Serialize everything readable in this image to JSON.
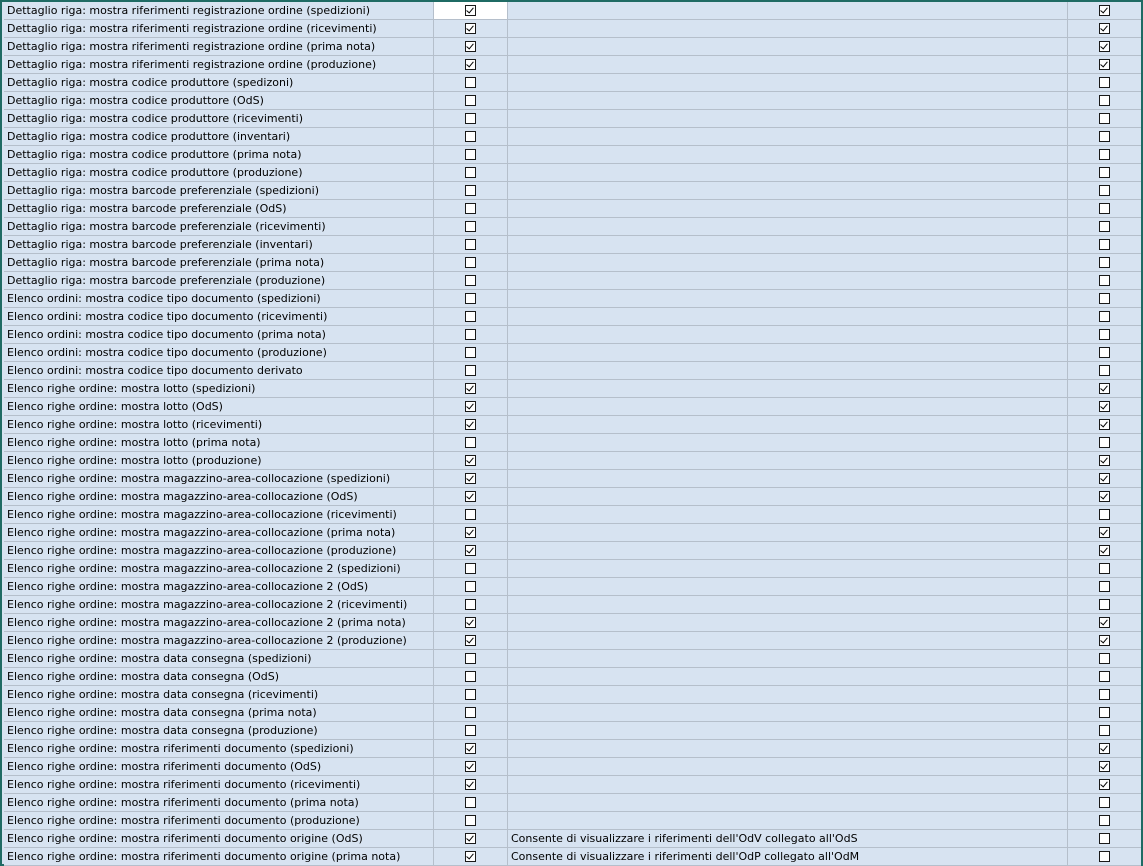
{
  "rows": [
    {
      "label": "Dettaglio riga: mostra riferimenti registrazione ordine (spedizioni)",
      "enabled": true,
      "description": "",
      "default": true
    },
    {
      "label": "Dettaglio riga: mostra riferimenti registrazione ordine (ricevimenti)",
      "enabled": true,
      "description": "",
      "default": true
    },
    {
      "label": "Dettaglio riga: mostra riferimenti registrazione ordine (prima nota)",
      "enabled": true,
      "description": "",
      "default": true
    },
    {
      "label": "Dettaglio riga: mostra riferimenti registrazione ordine (produzione)",
      "enabled": true,
      "description": "",
      "default": true
    },
    {
      "label": "Dettaglio riga: mostra codice produttore (spedizoni)",
      "enabled": false,
      "description": "",
      "default": false
    },
    {
      "label": "Dettaglio riga: mostra codice produttore (OdS)",
      "enabled": false,
      "description": "",
      "default": false
    },
    {
      "label": "Dettaglio riga: mostra codice produttore (ricevimenti)",
      "enabled": false,
      "description": "",
      "default": false
    },
    {
      "label": "Dettaglio riga: mostra codice produttore (inventari)",
      "enabled": false,
      "description": "",
      "default": false
    },
    {
      "label": "Dettaglio riga: mostra codice produttore (prima nota)",
      "enabled": false,
      "description": "",
      "default": false
    },
    {
      "label": "Dettaglio riga: mostra codice produttore (produzione)",
      "enabled": false,
      "description": "",
      "default": false
    },
    {
      "label": "Dettaglio riga: mostra barcode preferenziale (spedizioni)",
      "enabled": false,
      "description": "",
      "default": false
    },
    {
      "label": "Dettaglio riga: mostra barcode preferenziale (OdS)",
      "enabled": false,
      "description": "",
      "default": false
    },
    {
      "label": "Dettaglio riga: mostra barcode preferenziale (ricevimenti)",
      "enabled": false,
      "description": "",
      "default": false
    },
    {
      "label": "Dettaglio riga: mostra barcode preferenziale (inventari)",
      "enabled": false,
      "description": "",
      "default": false
    },
    {
      "label": "Dettaglio riga: mostra barcode preferenziale (prima nota)",
      "enabled": false,
      "description": "",
      "default": false
    },
    {
      "label": "Dettaglio riga: mostra barcode preferenziale (produzione)",
      "enabled": false,
      "description": "",
      "default": false
    },
    {
      "label": "Elenco ordini: mostra codice tipo documento (spedizioni)",
      "enabled": false,
      "description": "",
      "default": false
    },
    {
      "label": "Elenco ordini: mostra codice tipo documento (ricevimenti)",
      "enabled": false,
      "description": "",
      "default": false
    },
    {
      "label": "Elenco ordini: mostra codice tipo documento (prima nota)",
      "enabled": false,
      "description": "",
      "default": false
    },
    {
      "label": "Elenco ordini: mostra codice tipo documento (produzione)",
      "enabled": false,
      "description": "",
      "default": false
    },
    {
      "label": "Elenco ordini: mostra codice tipo documento derivato",
      "enabled": false,
      "description": "",
      "default": false
    },
    {
      "label": "Elenco righe ordine: mostra lotto (spedizioni)",
      "enabled": true,
      "description": "",
      "default": true
    },
    {
      "label": "Elenco righe ordine: mostra lotto (OdS)",
      "enabled": true,
      "description": "",
      "default": true
    },
    {
      "label": "Elenco righe ordine: mostra lotto (ricevimenti)",
      "enabled": true,
      "description": "",
      "default": true
    },
    {
      "label": "Elenco righe ordine: mostra lotto (prima nota)",
      "enabled": false,
      "description": "",
      "default": false
    },
    {
      "label": "Elenco righe ordine: mostra lotto (produzione)",
      "enabled": true,
      "description": "",
      "default": true
    },
    {
      "label": "Elenco righe ordine: mostra magazzino-area-collocazione (spedizioni)",
      "enabled": true,
      "description": "",
      "default": true
    },
    {
      "label": "Elenco righe ordine: mostra magazzino-area-collocazione (OdS)",
      "enabled": true,
      "description": "",
      "default": true
    },
    {
      "label": "Elenco righe ordine: mostra magazzino-area-collocazione (ricevimenti)",
      "enabled": false,
      "description": "",
      "default": false
    },
    {
      "label": "Elenco righe ordine: mostra magazzino-area-collocazione (prima nota)",
      "enabled": true,
      "description": "",
      "default": true
    },
    {
      "label": "Elenco righe ordine: mostra magazzino-area-collocazione (produzione)",
      "enabled": true,
      "description": "",
      "default": true
    },
    {
      "label": "Elenco righe ordine: mostra magazzino-area-collocazione 2 (spedizioni)",
      "enabled": false,
      "description": "",
      "default": false
    },
    {
      "label": "Elenco righe ordine: mostra magazzino-area-collocazione 2 (OdS)",
      "enabled": false,
      "description": "",
      "default": false
    },
    {
      "label": "Elenco righe ordine: mostra magazzino-area-collocazione 2 (ricevimenti)",
      "enabled": false,
      "description": "",
      "default": false
    },
    {
      "label": "Elenco righe ordine: mostra magazzino-area-collocazione 2 (prima nota)",
      "enabled": true,
      "description": "",
      "default": true
    },
    {
      "label": "Elenco righe ordine: mostra magazzino-area-collocazione 2 (produzione)",
      "enabled": true,
      "description": "",
      "default": true
    },
    {
      "label": "Elenco righe ordine: mostra data consegna (spedizioni)",
      "enabled": false,
      "description": "",
      "default": false
    },
    {
      "label": "Elenco righe ordine: mostra data consegna (OdS)",
      "enabled": false,
      "description": "",
      "default": false
    },
    {
      "label": "Elenco righe ordine: mostra data consegna (ricevimenti)",
      "enabled": false,
      "description": "",
      "default": false
    },
    {
      "label": "Elenco righe ordine: mostra data consegna (prima nota)",
      "enabled": false,
      "description": "",
      "default": false
    },
    {
      "label": "Elenco righe ordine: mostra data consegna (produzione)",
      "enabled": false,
      "description": "",
      "default": false
    },
    {
      "label": "Elenco righe ordine: mostra riferimenti documento (spedizioni)",
      "enabled": true,
      "description": "",
      "default": true
    },
    {
      "label": "Elenco righe ordine: mostra riferimenti documento (OdS)",
      "enabled": true,
      "description": "",
      "default": true
    },
    {
      "label": "Elenco righe ordine: mostra riferimenti documento (ricevimenti)",
      "enabled": true,
      "description": "",
      "default": true
    },
    {
      "label": "Elenco righe ordine: mostra riferimenti documento (prima nota)",
      "enabled": false,
      "description": "",
      "default": false
    },
    {
      "label": "Elenco righe ordine: mostra riferimenti documento (produzione)",
      "enabled": false,
      "description": "",
      "default": false
    },
    {
      "label": "Elenco righe ordine: mostra riferimenti documento origine (OdS)",
      "enabled": true,
      "description": "Consente di visualizzare i riferimenti dell'OdV collegato all'OdS",
      "default": false
    },
    {
      "label": "Elenco righe ordine: mostra riferimenti documento origine (prima nota)",
      "enabled": true,
      "description": "Consente di visualizzare i riferimenti dell'OdP collegato all'OdM",
      "default": false
    }
  ],
  "selected_row": 0,
  "colors": {
    "frame": "#1f6b64",
    "row_background": "#d7e3f1",
    "grid_line": "#b5bfcb",
    "selected_cell": "#ffffff"
  },
  "icons": {
    "checked": "checkbox-checked-icon",
    "unchecked": "checkbox-unchecked-icon"
  }
}
